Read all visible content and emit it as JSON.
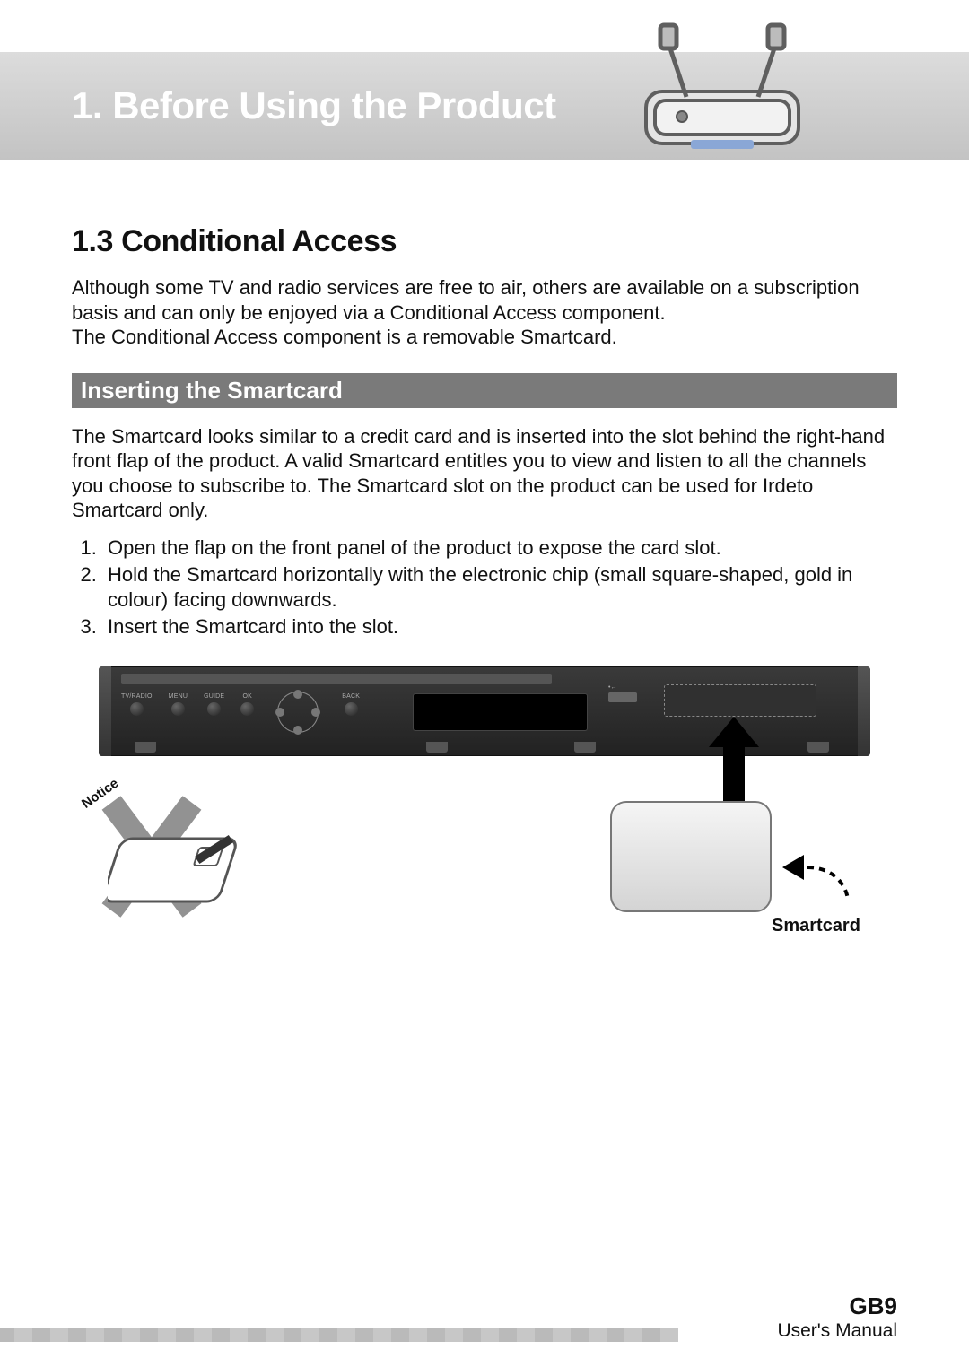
{
  "chapter": {
    "title": "1. Before Using the Product"
  },
  "section": {
    "number": "1.3",
    "title": "1.3 Conditional Access",
    "intro_p1": "Although some TV and radio services are free to air, others are available on a subscription basis and can only be enjoyed via a Conditional Access component.",
    "intro_p2": "The Conditional Access component is a removable Smartcard."
  },
  "subsection": {
    "title": "Inserting the Smartcard",
    "body": "The Smartcard looks similar to a credit card and is inserted into the slot behind the right-hand front flap of the product. A valid Smartcard entitles you to view and listen to all the channels you choose to subscribe to. The Smartcard slot on the product can be used for Irdeto Smartcard only.",
    "steps": [
      "Open the flap on the front panel of the product to expose the card slot.",
      "Hold the Smartcard horizontally with the electronic chip (small square-shaped, gold in colour) facing downwards.",
      "Insert the Smartcard into the slot."
    ]
  },
  "device": {
    "buttons": [
      "TV/RADIO",
      "MENU",
      "GUIDE",
      "OK"
    ],
    "back_button": "BACK"
  },
  "illustration": {
    "notice_label": "Notice",
    "smartcard_label": "Smartcard"
  },
  "footer": {
    "page": "GB9",
    "doc": "User's Manual"
  }
}
